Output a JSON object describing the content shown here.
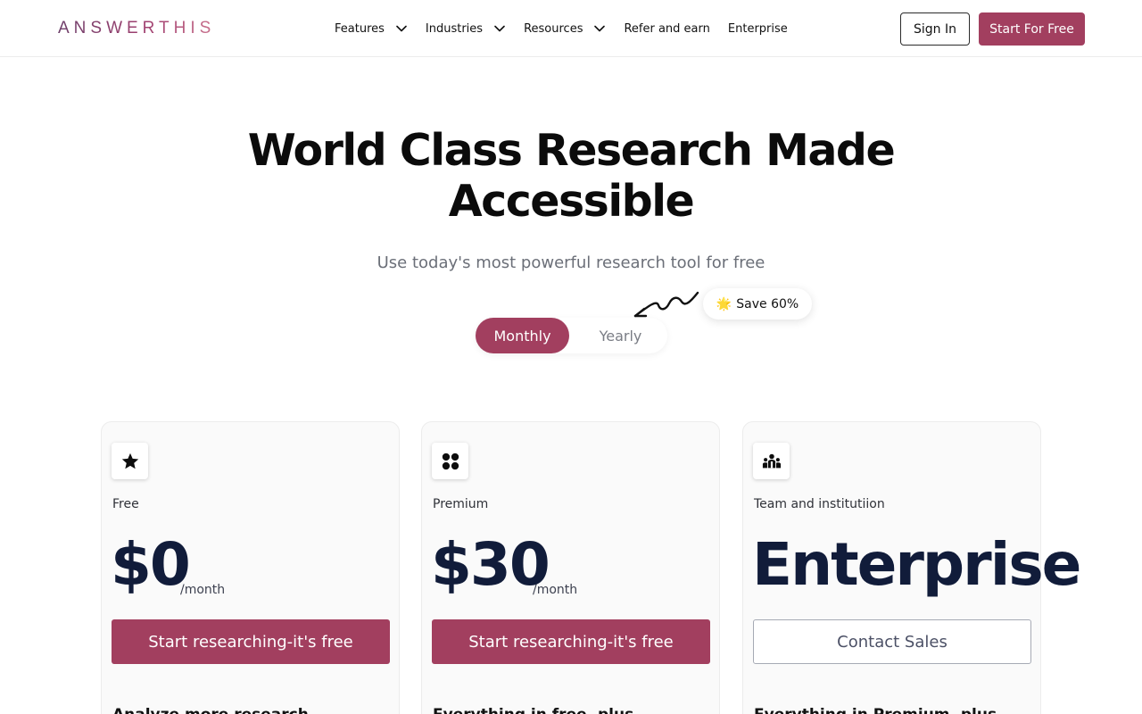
{
  "header": {
    "logo": "ANSWERTHIS",
    "nav": [
      {
        "label": "Features",
        "has_dropdown": true
      },
      {
        "label": "Industries",
        "has_dropdown": true
      },
      {
        "label": "Resources",
        "has_dropdown": true
      },
      {
        "label": "Refer and earn",
        "has_dropdown": false
      },
      {
        "label": "Enterprise",
        "has_dropdown": false
      }
    ],
    "sign_in": "Sign In",
    "start_free": "Start For Free"
  },
  "hero": {
    "title": "World Class Research Made Accessible",
    "subtitle": "Use today's most powerful research tool for free"
  },
  "billing": {
    "monthly": "Monthly",
    "yearly": "Yearly",
    "selected": "Monthly",
    "save_badge": "Save 60%",
    "save_icon": "sun-emoji"
  },
  "plans": [
    {
      "icon": "star-icon",
      "name": "Free",
      "price": "$0",
      "period": "/month",
      "cta": "Start researching-it's free",
      "features_heading": "Analyze more research"
    },
    {
      "icon": "clover-icon",
      "name": "Premium",
      "price": "$30",
      "period": "/month",
      "cta": "Start researching-it's free",
      "features_heading": "Everything in free, plus"
    },
    {
      "icon": "team-icon",
      "name": "Team and institutiion",
      "price": "Enterprise",
      "period": "",
      "cta": "Contact Sales",
      "features_heading": "Everything in Premium, plus"
    }
  ],
  "colors": {
    "brand": "#a23f5f",
    "price_text": "#111c3a",
    "card_bg": "#fafafa"
  }
}
